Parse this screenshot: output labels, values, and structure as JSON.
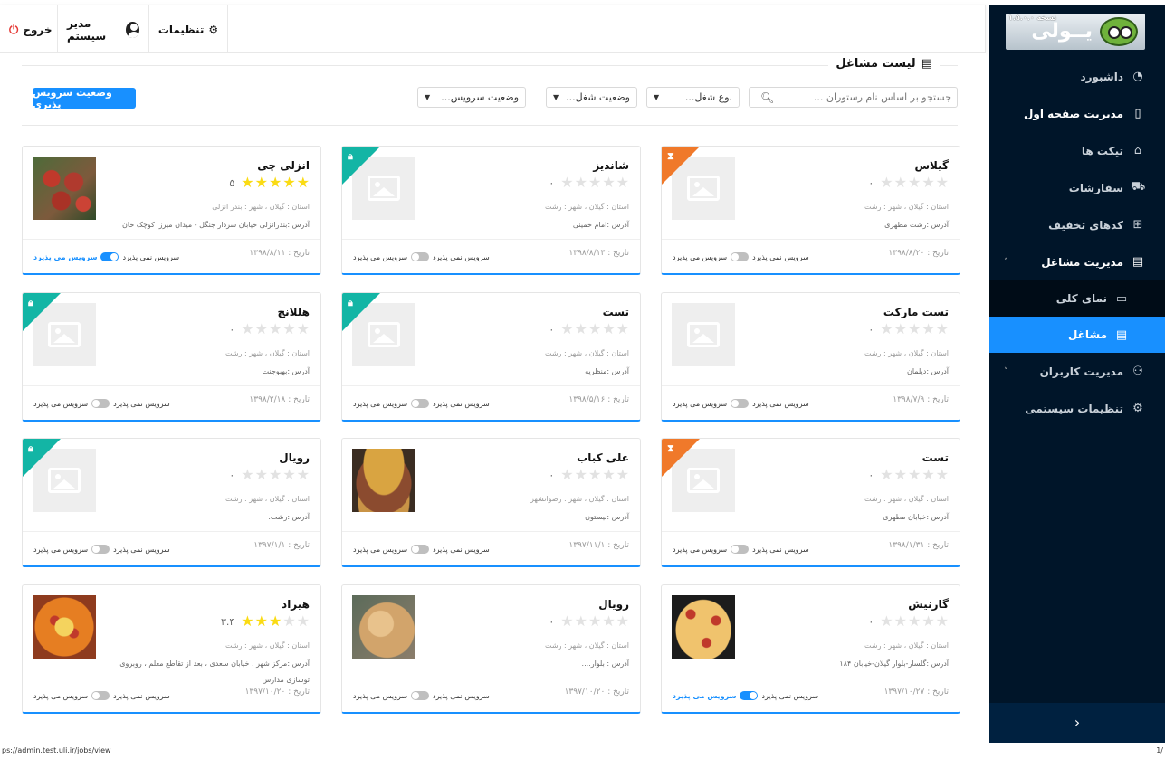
{
  "sidebar": {
    "logo_text": "یــولی",
    "version": "نسخه ۱.۵.۰.۰",
    "items": [
      {
        "label": "داشبورد",
        "icon": "dashboard-icon",
        "glyph": "◔"
      },
      {
        "label": "مدیریت صفحه اول",
        "icon": "mobile-icon",
        "glyph": "▯"
      },
      {
        "label": "تیکت ها",
        "icon": "tag-icon",
        "glyph": "⌂"
      },
      {
        "label": "سفارشات",
        "icon": "cart-icon",
        "glyph": "⛟"
      },
      {
        "label": "کدهای تخفیف",
        "icon": "gift-icon",
        "glyph": "⊞"
      },
      {
        "label": "مدیریت مشاغل",
        "icon": "shop-icon",
        "glyph": "▤"
      },
      {
        "label": "نمای کلی",
        "icon": "desktop-icon",
        "glyph": "▭"
      },
      {
        "label": "مشاغل",
        "icon": "shop-icon",
        "glyph": "▤"
      },
      {
        "label": "مدیریت کاربران",
        "icon": "users-icon",
        "glyph": "⚇"
      },
      {
        "label": "تنظیمات سیستمی",
        "icon": "settings-icon",
        "glyph": "⚙"
      }
    ],
    "collapse": "›"
  },
  "header": {
    "logout": "خروج",
    "admin": "مدیر سیستم",
    "settings": "تنظیمات"
  },
  "main": {
    "title": "لیست مشاغل",
    "search_placeholder": "جستجو بر اساس نام رستوران ...",
    "filters": [
      "نوع شغل...",
      "وضعیت شغل...",
      "وضعیت سرویس..."
    ],
    "service_status_button": "وضعیت سرویس پذیری"
  },
  "service_labels": {
    "off": "سرویس نمی پذیرد",
    "on": "سرویس می پذیرد"
  },
  "cards": [
    {
      "name": "گیلاس",
      "rating_text": "۰",
      "stars": 0,
      "location": "استان : گیلان  ، شهر : رشت",
      "address": "آدرس :رشت مطهری",
      "date": "تاریخ : ۱۳۹۸/۸/۲۰",
      "service_on": false,
      "corner": "orange",
      "corner_icon": "hourglass-icon"
    },
    {
      "name": "شاندیز",
      "rating_text": "۰",
      "stars": 0,
      "location": "استان : گیلان  ، شهر : رشت",
      "address": "آدرس :امام خمینی",
      "date": "تاریخ : ۱۳۹۸/۸/۱۳",
      "service_on": false,
      "corner": "teal",
      "corner_icon": "lock-icon"
    },
    {
      "name": "انزلی چی",
      "rating_text": "۵",
      "stars": 5,
      "location": "استان : گیلان  ، شهر : بندر انزلی",
      "address": "آدرس :بندرانزلی خیابان سردار جنگل - میدان میرزا کوچک خان",
      "date": "تاریخ : ۱۳۹۸/۸/۱۱",
      "service_on": true,
      "corner": "",
      "image": "food1"
    },
    {
      "name": "تست مارکت",
      "rating_text": "۰",
      "stars": 0,
      "location": "استان : گیلان  ، شهر : رشت",
      "address": "آدرس :دیلمان",
      "date": "تاریخ : ۱۳۹۸/۷/۹",
      "service_on": false,
      "corner": ""
    },
    {
      "name": "تست",
      "rating_text": "۰",
      "stars": 0,
      "location": "استان : گیلان  ، شهر : رشت",
      "address": "آدرس :منظریه",
      "date": "تاریخ : ۱۳۹۸/۵/۱۶",
      "service_on": false,
      "corner": "teal",
      "corner_icon": "lock-icon"
    },
    {
      "name": "هللانچ",
      "rating_text": "۰",
      "stars": 0,
      "location": "استان : گیلان  ، شهر : رشت",
      "address": "آدرس :بهبوجنت",
      "date": "تاریخ : ۱۳۹۸/۲/۱۸",
      "service_on": false,
      "corner": "teal",
      "corner_icon": "lock-icon"
    },
    {
      "name": "تست",
      "rating_text": "۰",
      "stars": 0,
      "location": "استان : گیلان  ، شهر : رشت",
      "address": "آدرس :خیابان مطهری",
      "date": "تاریخ : ۱۳۹۸/۱/۳۱",
      "service_on": false,
      "corner": "orange",
      "corner_icon": "hourglass-icon"
    },
    {
      "name": "علی کباب",
      "rating_text": "۰",
      "stars": 0,
      "location": "استان : گیلان  ، شهر : رضوانشهر",
      "address": "آدرس :بیستون",
      "date": "تاریخ : ۱۳۹۷/۱۱/۱",
      "service_on": false,
      "corner": "",
      "image": "food2"
    },
    {
      "name": "رویال",
      "rating_text": "۰",
      "stars": 0,
      "location": "استان : گیلان  ، شهر : رشت",
      "address": "آدرس :رشت.",
      "date": "تاریخ : ۱۳۹۷/۱/۱",
      "service_on": false,
      "corner": "teal",
      "corner_icon": "lock-icon"
    },
    {
      "name": "گارنیش",
      "rating_text": "۰",
      "stars": 0,
      "location": "استان : گیلان  ، شهر : رشت",
      "address": "آدرس :گلسار-بلوار گیلان-خیابان ۱۸۴",
      "date": "تاریخ : ۱۳۹۷/۱۰/۲۷",
      "service_on": true,
      "corner": "",
      "image": "food5"
    },
    {
      "name": "رویال",
      "rating_text": "۰",
      "stars": 0,
      "location": "استان : گیلان  ، شهر : رشت",
      "address": "آدرس : بلوار....",
      "date": "تاریخ : ۱۳۹۷/۱۰/۲۰",
      "service_on": false,
      "corner": "",
      "image": "food3"
    },
    {
      "name": "هیراد",
      "rating_text": "۳.۴",
      "stars": 3,
      "location": "استان : گیلان  ، شهر : رشت",
      "address": "آدرس :مرکز شهر ، خیابان سعدی ، بعد از تقاطع معلم ، روبروی توسازی مدارس",
      "date": "تاریخ : ۱۳۹۷/۱۰/۲۰",
      "service_on": false,
      "corner": "",
      "image": "food4"
    }
  ],
  "statusbar": {
    "url": "ps://admin.test.uli.ir/jobs/view",
    "page": "1/"
  }
}
